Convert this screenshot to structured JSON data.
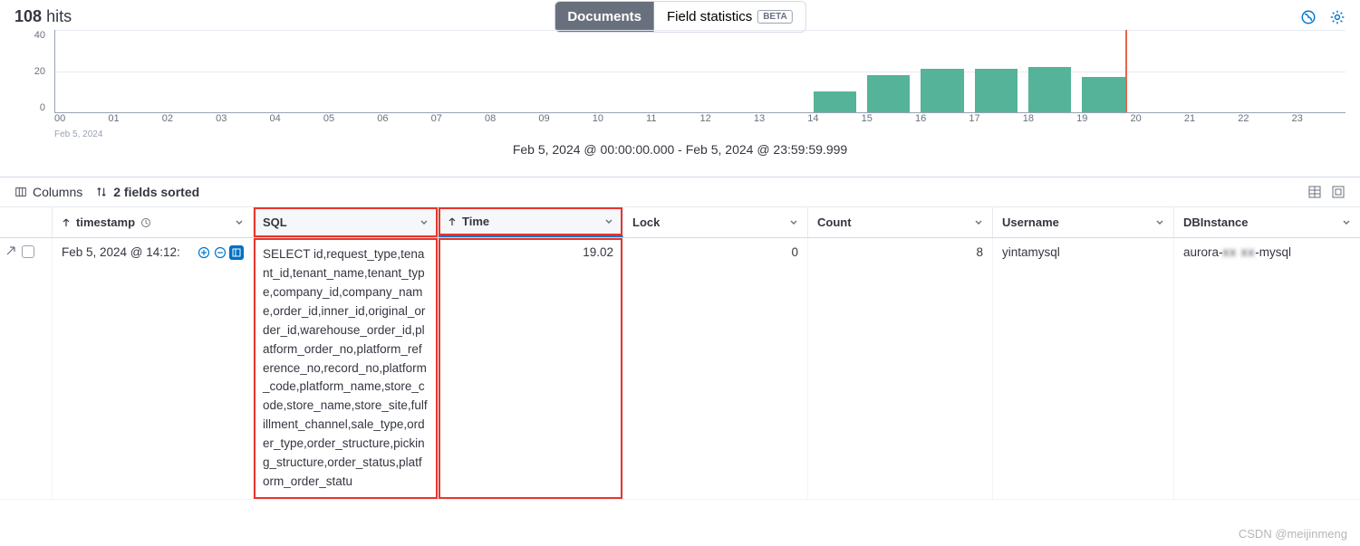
{
  "hits": {
    "count": "108",
    "label": "hits"
  },
  "tabs": {
    "documents": "Documents",
    "field_stats": "Field statistics",
    "beta": "BETA"
  },
  "chart_data": {
    "type": "bar",
    "categories": [
      "00",
      "01",
      "02",
      "03",
      "04",
      "05",
      "06",
      "07",
      "08",
      "09",
      "10",
      "11",
      "12",
      "13",
      "14",
      "15",
      "16",
      "17",
      "18",
      "19",
      "20",
      "21",
      "22",
      "23"
    ],
    "values": [
      0,
      0,
      0,
      0,
      0,
      0,
      0,
      0,
      0,
      0,
      0,
      0,
      0,
      0,
      10,
      18,
      21,
      21,
      22,
      17,
      0,
      0,
      0,
      0
    ],
    "x_date": "Feb 5, 2024",
    "ylim": [
      0,
      40
    ],
    "yticks": [
      "40",
      "20",
      "0"
    ],
    "marker_after_index": 19,
    "title": "",
    "xlabel": "",
    "ylabel": ""
  },
  "range_label": "Feb 5, 2024 @ 00:00:00.000 - Feb 5, 2024 @ 23:59:59.999",
  "toolbar": {
    "columns": "Columns",
    "sorted": "2 fields sorted"
  },
  "columns": {
    "timestamp": "timestamp",
    "sql": "SQL",
    "time": "Time",
    "lock": "Lock",
    "count": "Count",
    "username": "Username",
    "dbinstance": "DBInstance"
  },
  "row": {
    "timestamp": "Feb 5, 2024 @ 14:12:",
    "sql": "SELECT id,request_type,tenant_id,tenant_name,tenant_type,company_id,company_name,order_id,inner_id,original_order_id,warehouse_order_id,platform_order_no,platform_reference_no,record_no,platform_code,platform_name,store_code,store_name,store_site,fulfillment_channel,sale_type,order_type,order_structure,picking_structure,order_status,platform_order_statu",
    "time": "19.02",
    "lock": "0",
    "count": "8",
    "username": "yintamysql",
    "dbinstance_prefix": "aurora-",
    "dbinstance_suffix": "-mysql"
  },
  "watermark": "CSDN @meijinmeng"
}
